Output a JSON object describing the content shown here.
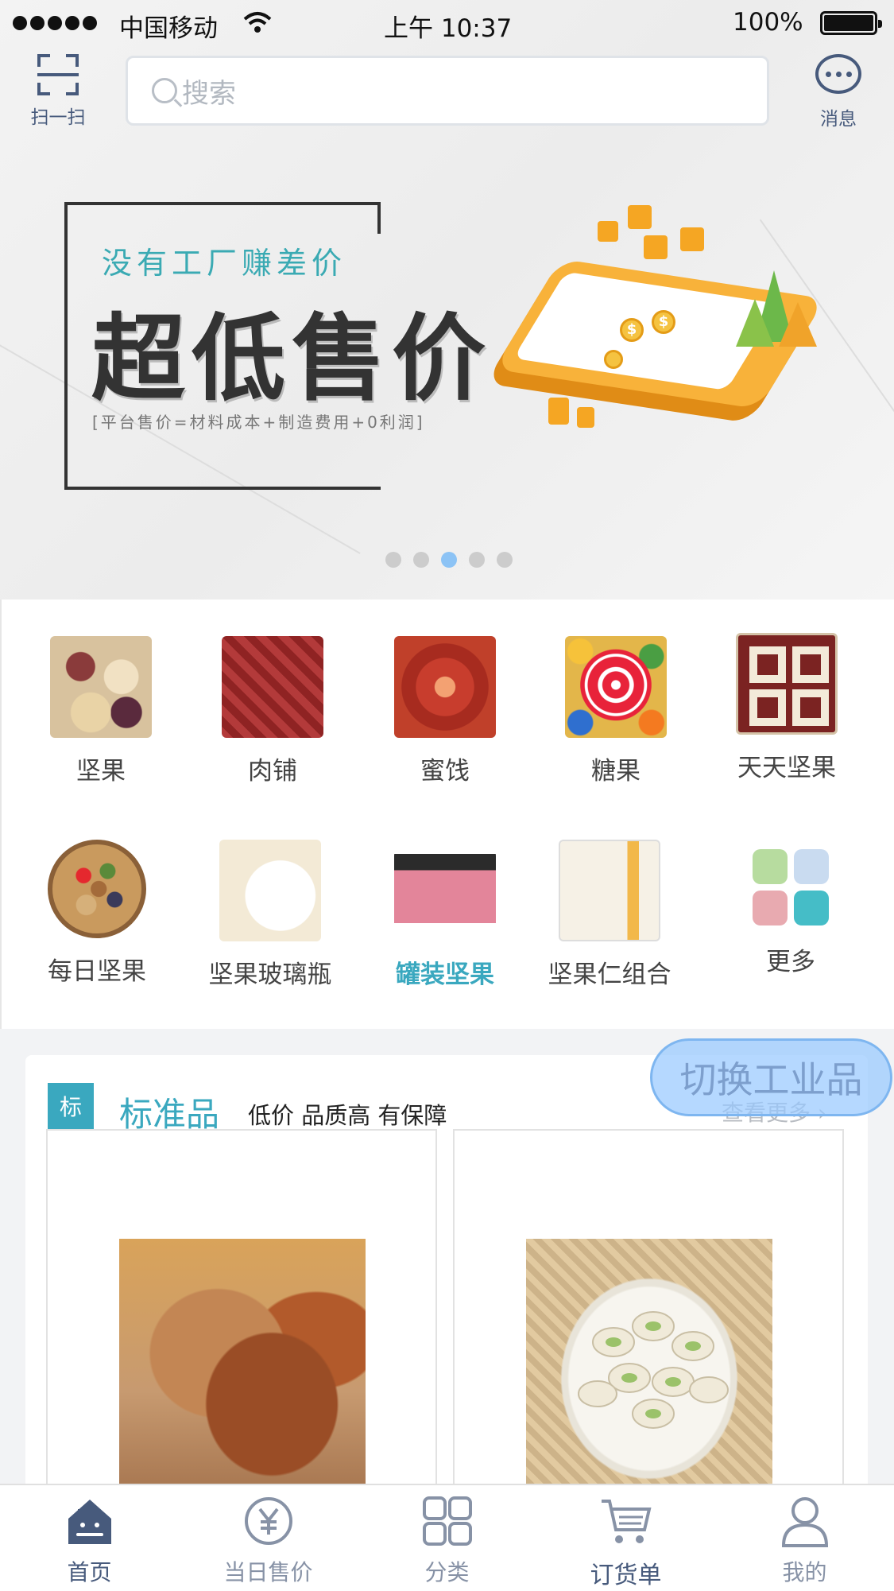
{
  "status_bar": {
    "carrier": "中国移动",
    "time": "上午 10:37",
    "battery": "100%"
  },
  "header": {
    "scan_label": "扫一扫",
    "search_placeholder": "搜索",
    "message_label": "消息"
  },
  "banner": {
    "subtitle": "没有工厂赚差价",
    "headline": "超低售价",
    "formula": "[平台售价=材料成本+制造费用+0利润]",
    "coin_symbol": "$",
    "slide_count": 5,
    "active_slide": 3
  },
  "categories": [
    {
      "name": "坚果",
      "icon": "nuts-photo"
    },
    {
      "name": "肉铺",
      "icon": "jerky-photo"
    },
    {
      "name": "蜜饯",
      "icon": "candied-fruit-photo"
    },
    {
      "name": "糖果",
      "icon": "lollipop-photo"
    },
    {
      "name": "天天坚果",
      "icon": "tiantian-logo"
    },
    {
      "name": "每日坚果",
      "icon": "daily-nuts-photo"
    },
    {
      "name": "坚果玻璃瓶",
      "icon": "nut-jar-photo"
    },
    {
      "name": "罐装坚果",
      "icon": "canned-nuts-photo",
      "active": true
    },
    {
      "name": "坚果仁组合",
      "icon": "nut-kernel-can-photo"
    },
    {
      "name": "更多",
      "icon": "more-grid-icon"
    }
  ],
  "standard": {
    "badge": "标",
    "title": "标准品",
    "slogan": "低价 品质高 有保障",
    "see_more": "查看更多 ›",
    "switch_label": "切换工业品"
  },
  "products": [
    {
      "name": "pecan-photo"
    },
    {
      "name": "pistachio-photo"
    }
  ],
  "tabbar": [
    {
      "label": "首页",
      "icon": "home-icon"
    },
    {
      "label": "当日售价",
      "icon": "yuan-icon"
    },
    {
      "label": "分类",
      "icon": "grid-icon"
    },
    {
      "label": "订货单",
      "icon": "cart-icon"
    },
    {
      "label": "我的",
      "icon": "user-icon"
    }
  ],
  "colors": {
    "accent": "#3aa8bf",
    "nav": "#475a7c",
    "banner_orange": "#f8b23a",
    "switch_bg": "#96c8ff"
  }
}
